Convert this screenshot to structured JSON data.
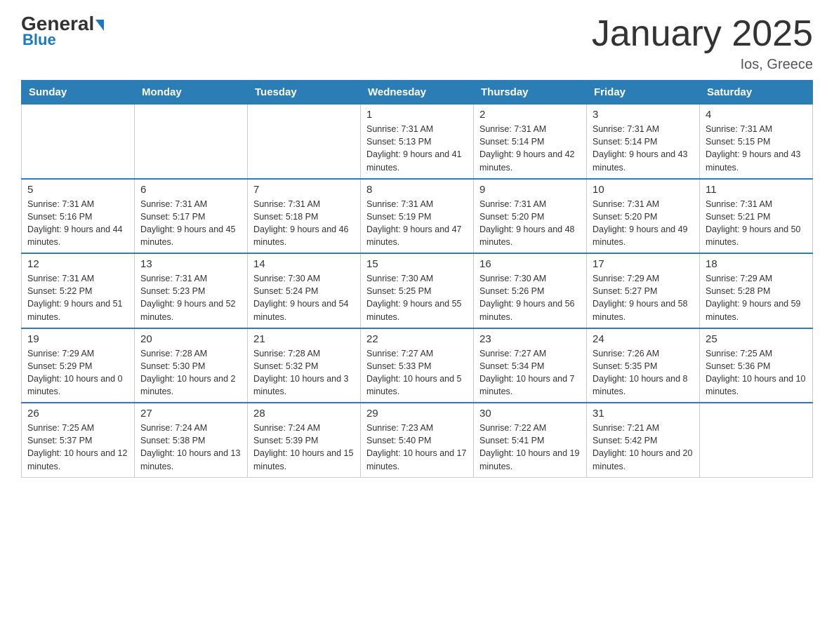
{
  "logo": {
    "general": "General",
    "blue": "Blue"
  },
  "title": "January 2025",
  "subtitle": "Ios, Greece",
  "headers": [
    "Sunday",
    "Monday",
    "Tuesday",
    "Wednesday",
    "Thursday",
    "Friday",
    "Saturday"
  ],
  "weeks": [
    [
      {
        "day": "",
        "sunrise": "",
        "sunset": "",
        "daylight": ""
      },
      {
        "day": "",
        "sunrise": "",
        "sunset": "",
        "daylight": ""
      },
      {
        "day": "",
        "sunrise": "",
        "sunset": "",
        "daylight": ""
      },
      {
        "day": "1",
        "sunrise": "Sunrise: 7:31 AM",
        "sunset": "Sunset: 5:13 PM",
        "daylight": "Daylight: 9 hours and 41 minutes."
      },
      {
        "day": "2",
        "sunrise": "Sunrise: 7:31 AM",
        "sunset": "Sunset: 5:14 PM",
        "daylight": "Daylight: 9 hours and 42 minutes."
      },
      {
        "day": "3",
        "sunrise": "Sunrise: 7:31 AM",
        "sunset": "Sunset: 5:14 PM",
        "daylight": "Daylight: 9 hours and 43 minutes."
      },
      {
        "day": "4",
        "sunrise": "Sunrise: 7:31 AM",
        "sunset": "Sunset: 5:15 PM",
        "daylight": "Daylight: 9 hours and 43 minutes."
      }
    ],
    [
      {
        "day": "5",
        "sunrise": "Sunrise: 7:31 AM",
        "sunset": "Sunset: 5:16 PM",
        "daylight": "Daylight: 9 hours and 44 minutes."
      },
      {
        "day": "6",
        "sunrise": "Sunrise: 7:31 AM",
        "sunset": "Sunset: 5:17 PM",
        "daylight": "Daylight: 9 hours and 45 minutes."
      },
      {
        "day": "7",
        "sunrise": "Sunrise: 7:31 AM",
        "sunset": "Sunset: 5:18 PM",
        "daylight": "Daylight: 9 hours and 46 minutes."
      },
      {
        "day": "8",
        "sunrise": "Sunrise: 7:31 AM",
        "sunset": "Sunset: 5:19 PM",
        "daylight": "Daylight: 9 hours and 47 minutes."
      },
      {
        "day": "9",
        "sunrise": "Sunrise: 7:31 AM",
        "sunset": "Sunset: 5:20 PM",
        "daylight": "Daylight: 9 hours and 48 minutes."
      },
      {
        "day": "10",
        "sunrise": "Sunrise: 7:31 AM",
        "sunset": "Sunset: 5:20 PM",
        "daylight": "Daylight: 9 hours and 49 minutes."
      },
      {
        "day": "11",
        "sunrise": "Sunrise: 7:31 AM",
        "sunset": "Sunset: 5:21 PM",
        "daylight": "Daylight: 9 hours and 50 minutes."
      }
    ],
    [
      {
        "day": "12",
        "sunrise": "Sunrise: 7:31 AM",
        "sunset": "Sunset: 5:22 PM",
        "daylight": "Daylight: 9 hours and 51 minutes."
      },
      {
        "day": "13",
        "sunrise": "Sunrise: 7:31 AM",
        "sunset": "Sunset: 5:23 PM",
        "daylight": "Daylight: 9 hours and 52 minutes."
      },
      {
        "day": "14",
        "sunrise": "Sunrise: 7:30 AM",
        "sunset": "Sunset: 5:24 PM",
        "daylight": "Daylight: 9 hours and 54 minutes."
      },
      {
        "day": "15",
        "sunrise": "Sunrise: 7:30 AM",
        "sunset": "Sunset: 5:25 PM",
        "daylight": "Daylight: 9 hours and 55 minutes."
      },
      {
        "day": "16",
        "sunrise": "Sunrise: 7:30 AM",
        "sunset": "Sunset: 5:26 PM",
        "daylight": "Daylight: 9 hours and 56 minutes."
      },
      {
        "day": "17",
        "sunrise": "Sunrise: 7:29 AM",
        "sunset": "Sunset: 5:27 PM",
        "daylight": "Daylight: 9 hours and 58 minutes."
      },
      {
        "day": "18",
        "sunrise": "Sunrise: 7:29 AM",
        "sunset": "Sunset: 5:28 PM",
        "daylight": "Daylight: 9 hours and 59 minutes."
      }
    ],
    [
      {
        "day": "19",
        "sunrise": "Sunrise: 7:29 AM",
        "sunset": "Sunset: 5:29 PM",
        "daylight": "Daylight: 10 hours and 0 minutes."
      },
      {
        "day": "20",
        "sunrise": "Sunrise: 7:28 AM",
        "sunset": "Sunset: 5:30 PM",
        "daylight": "Daylight: 10 hours and 2 minutes."
      },
      {
        "day": "21",
        "sunrise": "Sunrise: 7:28 AM",
        "sunset": "Sunset: 5:32 PM",
        "daylight": "Daylight: 10 hours and 3 minutes."
      },
      {
        "day": "22",
        "sunrise": "Sunrise: 7:27 AM",
        "sunset": "Sunset: 5:33 PM",
        "daylight": "Daylight: 10 hours and 5 minutes."
      },
      {
        "day": "23",
        "sunrise": "Sunrise: 7:27 AM",
        "sunset": "Sunset: 5:34 PM",
        "daylight": "Daylight: 10 hours and 7 minutes."
      },
      {
        "day": "24",
        "sunrise": "Sunrise: 7:26 AM",
        "sunset": "Sunset: 5:35 PM",
        "daylight": "Daylight: 10 hours and 8 minutes."
      },
      {
        "day": "25",
        "sunrise": "Sunrise: 7:25 AM",
        "sunset": "Sunset: 5:36 PM",
        "daylight": "Daylight: 10 hours and 10 minutes."
      }
    ],
    [
      {
        "day": "26",
        "sunrise": "Sunrise: 7:25 AM",
        "sunset": "Sunset: 5:37 PM",
        "daylight": "Daylight: 10 hours and 12 minutes."
      },
      {
        "day": "27",
        "sunrise": "Sunrise: 7:24 AM",
        "sunset": "Sunset: 5:38 PM",
        "daylight": "Daylight: 10 hours and 13 minutes."
      },
      {
        "day": "28",
        "sunrise": "Sunrise: 7:24 AM",
        "sunset": "Sunset: 5:39 PM",
        "daylight": "Daylight: 10 hours and 15 minutes."
      },
      {
        "day": "29",
        "sunrise": "Sunrise: 7:23 AM",
        "sunset": "Sunset: 5:40 PM",
        "daylight": "Daylight: 10 hours and 17 minutes."
      },
      {
        "day": "30",
        "sunrise": "Sunrise: 7:22 AM",
        "sunset": "Sunset: 5:41 PM",
        "daylight": "Daylight: 10 hours and 19 minutes."
      },
      {
        "day": "31",
        "sunrise": "Sunrise: 7:21 AM",
        "sunset": "Sunset: 5:42 PM",
        "daylight": "Daylight: 10 hours and 20 minutes."
      },
      {
        "day": "",
        "sunrise": "",
        "sunset": "",
        "daylight": ""
      }
    ]
  ]
}
